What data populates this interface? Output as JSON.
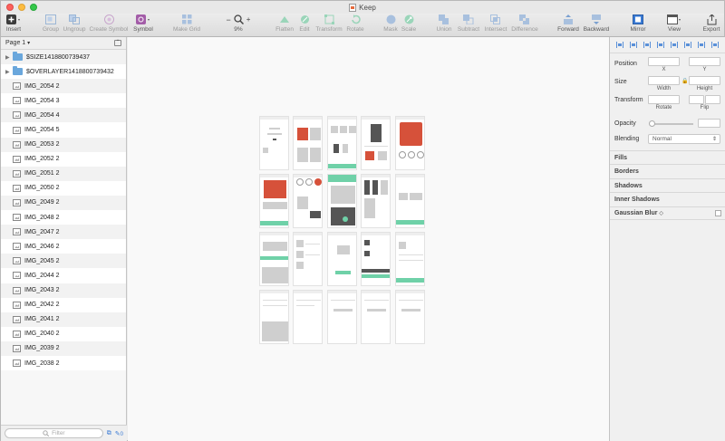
{
  "window": {
    "title": "Keep"
  },
  "toolbar": {
    "insert": "Insert",
    "group": "Group",
    "ungroup": "Ungroup",
    "create_symbol": "Create Symbol",
    "symbol": "Symbol",
    "make_grid": "Make Grid",
    "zoom": "9%",
    "zoom_minus": "−",
    "zoom_plus": "+",
    "flatten": "Flatten",
    "edit": "Edit",
    "transform": "Transform",
    "rotate": "Rotate",
    "mask": "Mask",
    "scale": "Scale",
    "union": "Union",
    "subtract": "Subtract",
    "intersect": "Intersect",
    "difference": "Difference",
    "forward": "Forward",
    "backward": "Backward",
    "mirror": "Mirror",
    "view": "View",
    "export": "Export"
  },
  "sidebar": {
    "page_label": "Page 1",
    "page_caret": "▾",
    "filter_placeholder": "Filter",
    "count": "0",
    "layers": [
      {
        "name": "$SIZE1418800739437",
        "kind": "folder"
      },
      {
        "name": "$OVERLAYER1418800739432",
        "kind": "folder"
      },
      {
        "name": "IMG_2054 2",
        "kind": "image"
      },
      {
        "name": "IMG_2054 3",
        "kind": "image"
      },
      {
        "name": "IMG_2054 4",
        "kind": "image"
      },
      {
        "name": "IMG_2054 5",
        "kind": "image"
      },
      {
        "name": "IMG_2053 2",
        "kind": "image"
      },
      {
        "name": "IMG_2052 2",
        "kind": "image"
      },
      {
        "name": "IMG_2051 2",
        "kind": "image"
      },
      {
        "name": "IMG_2050 2",
        "kind": "image"
      },
      {
        "name": "IMG_2049 2",
        "kind": "image"
      },
      {
        "name": "IMG_2048 2",
        "kind": "image"
      },
      {
        "name": "IMG_2047 2",
        "kind": "image"
      },
      {
        "name": "IMG_2046 2",
        "kind": "image"
      },
      {
        "name": "IMG_2045 2",
        "kind": "image"
      },
      {
        "name": "IMG_2044 2",
        "kind": "image"
      },
      {
        "name": "IMG_2043 2",
        "kind": "image"
      },
      {
        "name": "IMG_2042 2",
        "kind": "image"
      },
      {
        "name": "IMG_2041 2",
        "kind": "image"
      },
      {
        "name": "IMG_2040 2",
        "kind": "image"
      },
      {
        "name": "IMG_2039 2",
        "kind": "image"
      },
      {
        "name": "IMG_2038 2",
        "kind": "image"
      }
    ]
  },
  "inspector": {
    "position": "Position",
    "x": "X",
    "y": "Y",
    "size": "Size",
    "width": "Width",
    "height": "Height",
    "transform": "Transform",
    "rotate": "Rotate",
    "flip": "Flip",
    "opacity": "Opacity",
    "blending": "Blending",
    "blending_value": "Normal",
    "fills": "Fills",
    "borders": "Borders",
    "shadows": "Shadows",
    "inner_shadows": "Inner Shadows",
    "gaussian_blur": "Gaussian Blur",
    "gaussian_caret": "◇"
  },
  "colors": {
    "accent_green": "#6fd1a8",
    "product_red": "#d6513a",
    "select_blue": "#3a7bd5"
  }
}
